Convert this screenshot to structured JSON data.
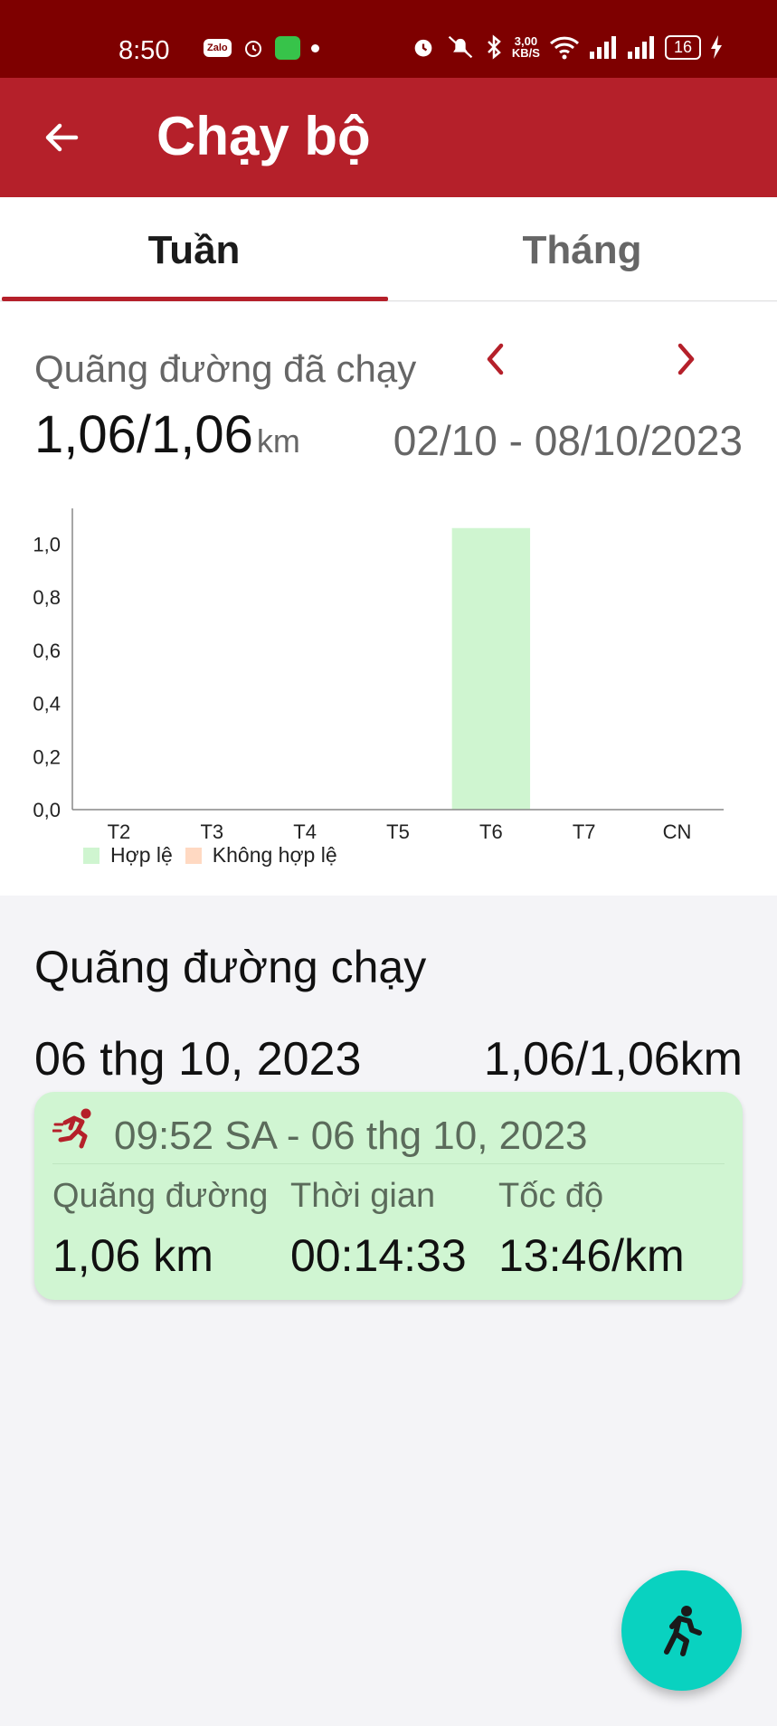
{
  "status_bar": {
    "time": "8:50",
    "zalo_label": "Zalo",
    "net_speed_value": "3,00",
    "net_speed_unit": "KB/S",
    "battery": "16"
  },
  "app_bar": {
    "title": "Chạy bộ",
    "color": "#b5202a"
  },
  "tabs": [
    {
      "label": "Tuần",
      "selected": true
    },
    {
      "label": "Tháng",
      "selected": false
    }
  ],
  "summary": {
    "label": "Quãng đường đã chạy",
    "total": "1,06/1,06",
    "unit": "km",
    "date_range": "02/10 - 08/10/2023"
  },
  "chart_data": {
    "type": "bar",
    "categories": [
      "T2",
      "T3",
      "T4",
      "T5",
      "T6",
      "T7",
      "CN"
    ],
    "series": [
      {
        "name": "Hợp lệ",
        "color": "#cff5d0",
        "values": [
          0,
          0,
          0,
          0,
          1.06,
          0,
          0
        ]
      },
      {
        "name": "Không hợp lệ",
        "color": "#ffd9c2",
        "values": [
          0,
          0,
          0,
          0,
          0,
          0,
          0
        ]
      }
    ],
    "y_ticks": [
      "0,0",
      "0,2",
      "0,4",
      "0,6",
      "0,8",
      "1,0"
    ],
    "ylim": [
      0,
      1.1
    ],
    "legend_position": "bottom-left"
  },
  "runs": {
    "section_title": "Quãng đường chạy",
    "days": [
      {
        "date": "06 thg 10, 2023",
        "total": "1,06/1,06km",
        "entries": [
          {
            "time": "09:52 SA - 06 thg 10, 2023",
            "distance_label": "Quãng đường",
            "distance": "1,06 km",
            "duration_label": "Thời gian",
            "duration": "00:14:33",
            "pace_label": "Tốc độ",
            "pace": "13:46/km",
            "card_color": "#d0f5d2",
            "icon": "runner-icon"
          }
        ]
      }
    ]
  },
  "fab": {
    "icon": "runner-icon",
    "color": "#09d2c0"
  }
}
